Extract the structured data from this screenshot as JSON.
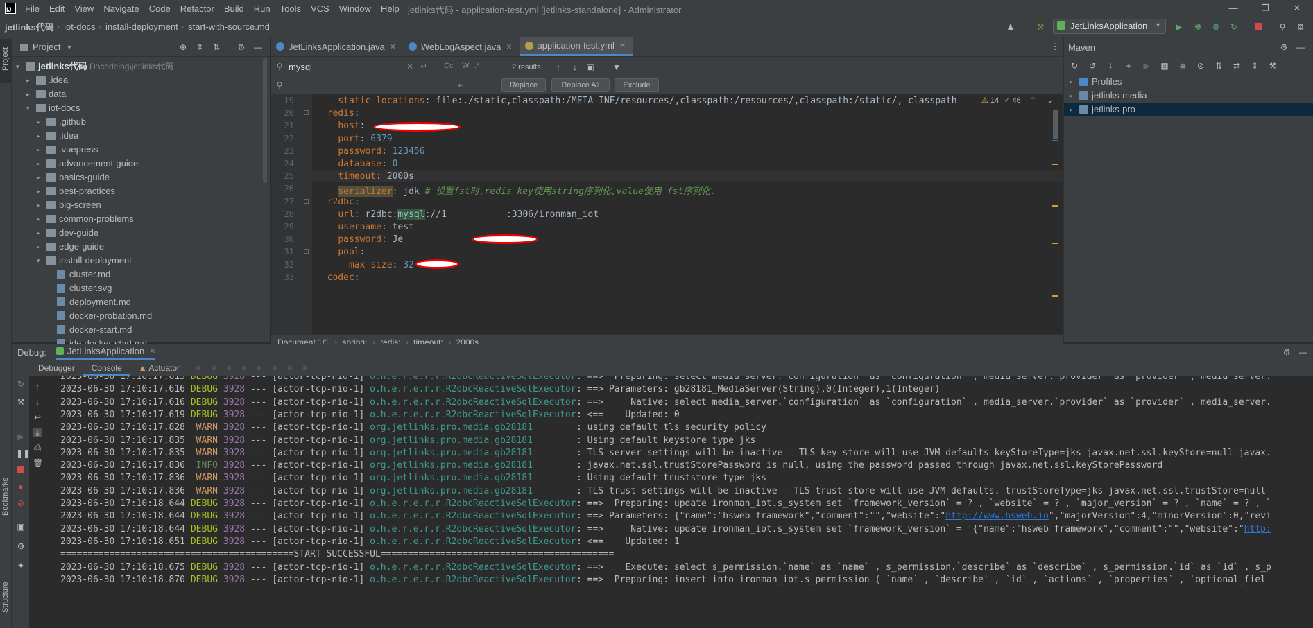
{
  "titlebar": {
    "menu": [
      "File",
      "Edit",
      "View",
      "Navigate",
      "Code",
      "Refactor",
      "Build",
      "Run",
      "Tools",
      "VCS",
      "Window",
      "Help"
    ],
    "title": "jetlinks代码 - application-test.yml [jetlinks-standalone] - Administrator"
  },
  "navbar": {
    "crumbs": [
      "jetlinks代码",
      "iot-docs",
      "install-deployment",
      "start-with-source.md"
    ],
    "run_config": "JetLinksApplication"
  },
  "project": {
    "title": "Project",
    "root": {
      "name": "jetlinks代码",
      "path": "D:\\codeing\\jetlinks代码"
    },
    "items": [
      {
        "name": ".idea",
        "depth": 1,
        "type": "folder"
      },
      {
        "name": "data",
        "depth": 1,
        "type": "folder"
      },
      {
        "name": "iot-docs",
        "depth": 1,
        "type": "folder",
        "open": true
      },
      {
        "name": ".github",
        "depth": 2,
        "type": "folder"
      },
      {
        "name": ".idea",
        "depth": 2,
        "type": "folder"
      },
      {
        "name": ".vuepress",
        "depth": 2,
        "type": "folder"
      },
      {
        "name": "advancement-guide",
        "depth": 2,
        "type": "folder"
      },
      {
        "name": "basics-guide",
        "depth": 2,
        "type": "folder"
      },
      {
        "name": "best-practices",
        "depth": 2,
        "type": "folder"
      },
      {
        "name": "big-screen",
        "depth": 2,
        "type": "folder"
      },
      {
        "name": "common-problems",
        "depth": 2,
        "type": "folder"
      },
      {
        "name": "dev-guide",
        "depth": 2,
        "type": "folder"
      },
      {
        "name": "edge-guide",
        "depth": 2,
        "type": "folder"
      },
      {
        "name": "install-deployment",
        "depth": 2,
        "type": "folder",
        "open": true
      },
      {
        "name": "cluster.md",
        "depth": 3,
        "type": "file"
      },
      {
        "name": "cluster.svg",
        "depth": 3,
        "type": "file"
      },
      {
        "name": "deployment.md",
        "depth": 3,
        "type": "file"
      },
      {
        "name": "docker-probation.md",
        "depth": 3,
        "type": "file"
      },
      {
        "name": "docker-start.md",
        "depth": 3,
        "type": "file"
      },
      {
        "name": "ide-docker-start.md",
        "depth": 3,
        "type": "file"
      }
    ]
  },
  "editor": {
    "tabs": [
      {
        "label": "JetLinksApplication.java",
        "active": false
      },
      {
        "label": "WebLogAspect.java",
        "active": false
      },
      {
        "label": "application-test.yml",
        "active": true
      }
    ],
    "find": {
      "query": "mysql",
      "results": "2 results",
      "replace_label": "Replace",
      "replace_all_label": "Replace All",
      "exclude_label": "Exclude",
      "match_case": "Cc",
      "words": "W",
      "regex": ".*"
    },
    "inspections": {
      "warnings": "14",
      "weak_warnings": "46"
    },
    "lines": [
      {
        "n": "19",
        "text": "    static-locations: file:./static,classpath:/META-INF/resources/,classpath:/resources/,classpath:/static/, classpath"
      },
      {
        "n": "20",
        "text": "  redis:"
      },
      {
        "n": "21",
        "text": "    host: "
      },
      {
        "n": "22",
        "text": "    port: 6379"
      },
      {
        "n": "23",
        "text": "    password: 123456"
      },
      {
        "n": "24",
        "text": "    database: 0"
      },
      {
        "n": "25",
        "text": "    timeout: 2000s"
      },
      {
        "n": "26",
        "text": "    serializer: jdk # 设置fst时,redis key使用string序列化,value使用 fst序列化."
      },
      {
        "n": "27",
        "text": "  r2dbc:"
      },
      {
        "n": "28",
        "text": "    url: r2dbc:mysql://1           :3306/ironman_iot"
      },
      {
        "n": "29",
        "text": "    username: test"
      },
      {
        "n": "30",
        "text": "    password: Je"
      },
      {
        "n": "31",
        "text": "    pool:"
      },
      {
        "n": "32",
        "text": "      max-size: 32"
      },
      {
        "n": "33",
        "text": "  codec:"
      }
    ],
    "breadcrumb": [
      "Document 1/1",
      "spring:",
      "redis:",
      "timeout:",
      "2000s"
    ]
  },
  "maven": {
    "title": "Maven",
    "items": [
      "Profiles",
      "jetlinks-media",
      "jetlinks-pro"
    ]
  },
  "debug": {
    "title": "Debug:",
    "session": "JetLinksApplication",
    "tabs": [
      "Debugger",
      "Console",
      "Actuator"
    ],
    "log": [
      {
        "ts": "2023-06-30 17:10:17.615",
        "lvl": "DEBUG",
        "pid": "3928",
        "thread": "[actor-tcp-nio-1]",
        "logger": "o.h.e.r.e.r.r.R2dbcReactiveSqlExecutor",
        "msg": ": ==>  Preparing: select media_server.`configuration` as `configuration` , media_server.`provider` as `provider` , media_server.`"
      },
      {
        "ts": "2023-06-30 17:10:17.616",
        "lvl": "DEBUG",
        "pid": "3928",
        "thread": "[actor-tcp-nio-1]",
        "logger": "o.h.e.r.e.r.r.R2dbcReactiveSqlExecutor",
        "msg": ": ==> Parameters: gb28181_MediaServer(String),0(Integer),1(Integer)"
      },
      {
        "ts": "2023-06-30 17:10:17.616",
        "lvl": "DEBUG",
        "pid": "3928",
        "thread": "[actor-tcp-nio-1]",
        "logger": "o.h.e.r.e.r.r.R2dbcReactiveSqlExecutor",
        "msg": ": ==>     Native: select media_server.`configuration` as `configuration` , media_server.`provider` as `provider` , media_server."
      },
      {
        "ts": "2023-06-30 17:10:17.619",
        "lvl": "DEBUG",
        "pid": "3928",
        "thread": "[actor-tcp-nio-1]",
        "logger": "o.h.e.r.e.r.r.R2dbcReactiveSqlExecutor",
        "msg": ": <==    Updated: 0"
      },
      {
        "ts": "2023-06-30 17:10:17.828",
        "lvl": " WARN",
        "pid": "3928",
        "thread": "[actor-tcp-nio-1]",
        "logger": "org.jetlinks.pro.media.gb28181",
        "msg": ": using default tls security policy"
      },
      {
        "ts": "2023-06-30 17:10:17.835",
        "lvl": " WARN",
        "pid": "3928",
        "thread": "[actor-tcp-nio-1]",
        "logger": "org.jetlinks.pro.media.gb28181",
        "msg": ": Using default keystore type jks"
      },
      {
        "ts": "2023-06-30 17:10:17.835",
        "lvl": " WARN",
        "pid": "3928",
        "thread": "[actor-tcp-nio-1]",
        "logger": "org.jetlinks.pro.media.gb28181",
        "msg": ": TLS server settings will be inactive - TLS key store will use JVM defaults keyStoreType=jks javax.net.ssl.keyStore=null javax."
      },
      {
        "ts": "2023-06-30 17:10:17.836",
        "lvl": " INFO",
        "pid": "3928",
        "thread": "[actor-tcp-nio-1]",
        "logger": "org.jetlinks.pro.media.gb28181",
        "msg": ": javax.net.ssl.trustStorePassword is null, using the password passed through javax.net.ssl.keyStorePassword"
      },
      {
        "ts": "2023-06-30 17:10:17.836",
        "lvl": " WARN",
        "pid": "3928",
        "thread": "[actor-tcp-nio-1]",
        "logger": "org.jetlinks.pro.media.gb28181",
        "msg": ": Using default truststore type jks"
      },
      {
        "ts": "2023-06-30 17:10:17.836",
        "lvl": " WARN",
        "pid": "3928",
        "thread": "[actor-tcp-nio-1]",
        "logger": "org.jetlinks.pro.media.gb28181",
        "msg": ": TLS trust settings will be inactive - TLS trust store will use JVM defaults. trustStoreType=jks javax.net.ssl.trustStore=null"
      },
      {
        "ts": "2023-06-30 17:10:18.644",
        "lvl": "DEBUG",
        "pid": "3928",
        "thread": "[actor-tcp-nio-1]",
        "logger": "o.h.e.r.e.r.r.R2dbcReactiveSqlExecutor",
        "msg": ": ==>  Preparing: update ironman_iot.s_system set `framework_version` = ? , `website` = ? , `major_version` = ? , `name` = ? , `"
      },
      {
        "ts": "2023-06-30 17:10:18.644",
        "lvl": "DEBUG",
        "pid": "3928",
        "thread": "[actor-tcp-nio-1]",
        "logger": "o.h.e.r.e.r.r.R2dbcReactiveSqlExecutor",
        "msg": ": ==> Parameters: {\"name\":\"hsweb framework\",\"comment\":\"\",\"website\":\"",
        "link": "http://www.hsweb.io",
        "after": "\",\"majorVersion\":4,\"minorVersion\":0,\"revi"
      },
      {
        "ts": "2023-06-30 17:10:18.644",
        "lvl": "DEBUG",
        "pid": "3928",
        "thread": "[actor-tcp-nio-1]",
        "logger": "o.h.e.r.e.r.r.R2dbcReactiveSqlExecutor",
        "msg": ": ==>     Native: update ironman_iot.s_system set `framework_version` = '{\"name\":\"hsweb framework\",\"comment\":\"\",\"website\":\"",
        "link": "http:",
        "after": ""
      },
      {
        "ts": "2023-06-30 17:10:18.651",
        "lvl": "DEBUG",
        "pid": "3928",
        "thread": "[actor-tcp-nio-1]",
        "logger": "o.h.e.r.e.r.r.R2dbcReactiveSqlExecutor",
        "msg": ": <==    Updated: 1"
      },
      {
        "raw": "===========================================START SUCCESSFUL==========================================="
      },
      {
        "ts": "2023-06-30 17:10:18.675",
        "lvl": "DEBUG",
        "pid": "3928",
        "thread": "[actor-tcp-nio-1]",
        "logger": "o.h.e.r.e.r.r.R2dbcReactiveSqlExecutor",
        "msg": ": ==>    Execute: select s_permission.`name` as `name` , s_permission.`describe` as `describe` , s_permission.`id` as `id` , s_p"
      },
      {
        "ts": "2023-06-30 17:10:18.870",
        "lvl": "DEBUG",
        "pid": "3928",
        "thread": "[actor-tcp-nio-1]",
        "logger": "o.h.e.r.e.r.r.R2dbcReactiveSqlExecutor",
        "msg": ": ==>  Preparing: insert into ironman_iot.s_permission ( `name` , `describe` , `id` , `actions` , `properties` , `optional_fiel"
      }
    ]
  },
  "left_strip": {
    "project": "Project",
    "bookmarks": "Bookmarks",
    "structure": "Structure"
  }
}
